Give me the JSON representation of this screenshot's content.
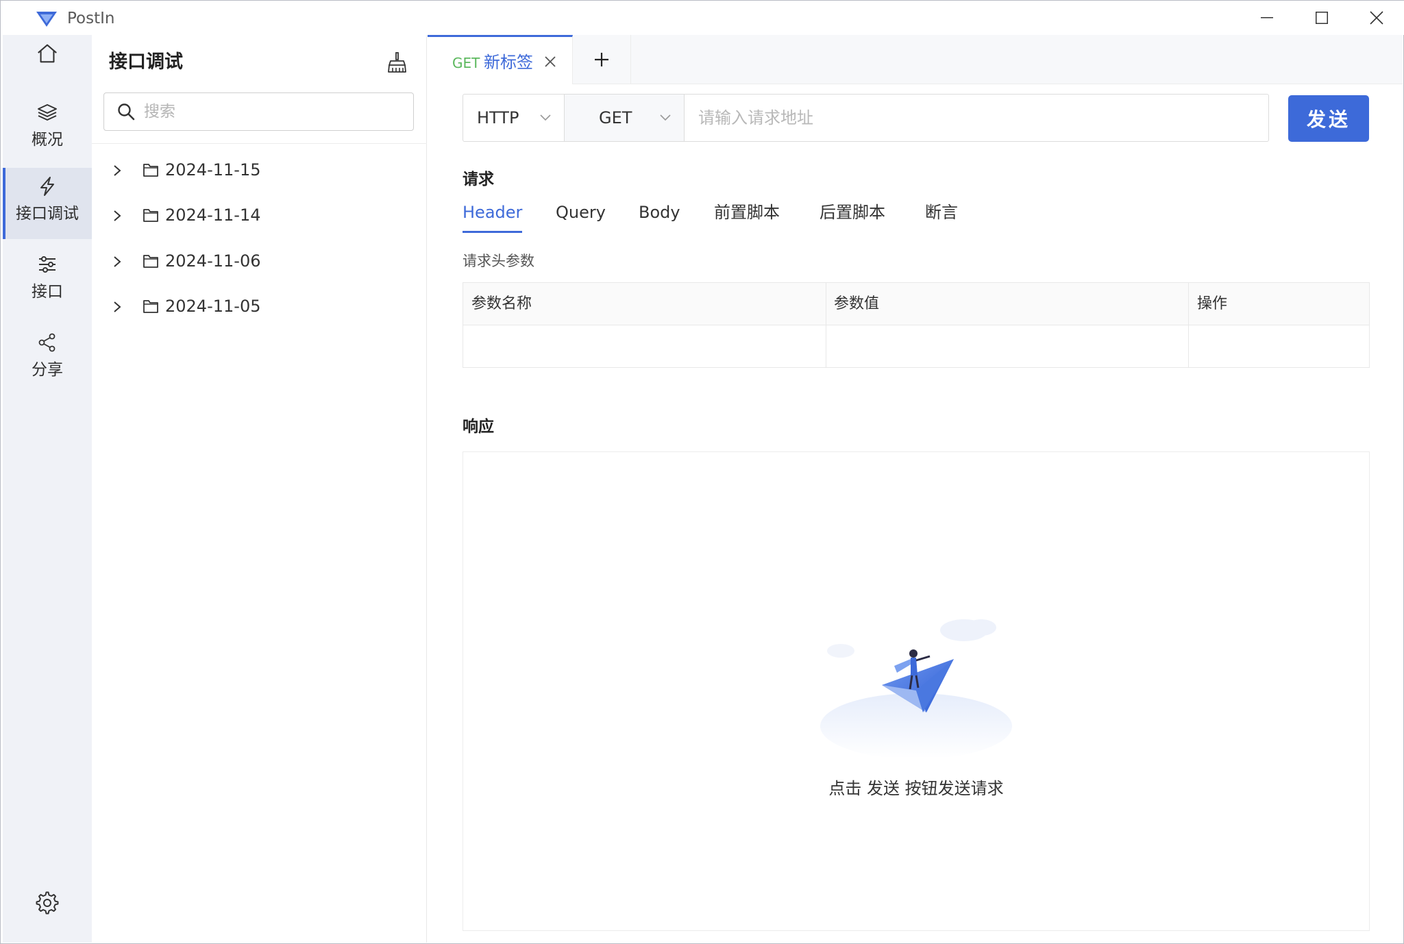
{
  "app": {
    "title": "PostIn"
  },
  "nav": {
    "items": [
      {
        "id": "home",
        "label": ""
      },
      {
        "id": "overview",
        "label": "概况"
      },
      {
        "id": "debug",
        "label": "接口调试"
      },
      {
        "id": "api",
        "label": "接口"
      },
      {
        "id": "share",
        "label": "分享"
      }
    ]
  },
  "tree": {
    "title": "接口调试",
    "search_placeholder": "搜索",
    "folders": [
      "2024-11-15",
      "2024-11-14",
      "2024-11-06",
      "2024-11-05"
    ]
  },
  "tabs": [
    {
      "method": "GET",
      "name": "新标签"
    }
  ],
  "request": {
    "protocol": "HTTP",
    "method": "GET",
    "url_placeholder": "请输入请求地址",
    "send_label": "发送",
    "section_title": "请求",
    "subtabs": [
      "Header",
      "Query",
      "Body",
      "前置脚本",
      "后置脚本",
      "断言"
    ],
    "active_subtab": "Header",
    "param_caption": "请求头参数",
    "table_headers": [
      "参数名称",
      "参数值",
      "操作"
    ]
  },
  "response": {
    "section_title": "响应",
    "empty_text": "点击 发送 按钮发送请求"
  },
  "colors": {
    "accent": "#3e6ad9",
    "method_get": "#5bb85d",
    "nav_bg": "#f0f2f7"
  }
}
